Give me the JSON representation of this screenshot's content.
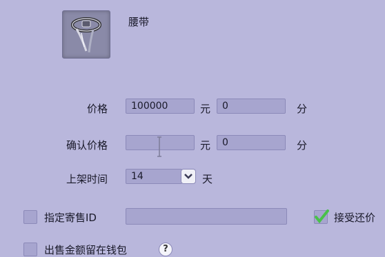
{
  "item": {
    "name": "腰带",
    "icon": "belt-icon"
  },
  "price": {
    "label": "价格",
    "yuan_value": "100000",
    "yuan_unit": "元",
    "fen_value": "0",
    "fen_unit": "分"
  },
  "confirm_price": {
    "label": "确认价格",
    "yuan_value": "",
    "yuan_unit": "元",
    "fen_value": "0",
    "fen_unit": "分"
  },
  "listing_time": {
    "label": "上架时间",
    "value": "14",
    "unit": "天"
  },
  "designated_buyer": {
    "label": "指定寄售ID",
    "checked": false,
    "value": ""
  },
  "accept_counteroffer": {
    "label": "接受还价",
    "checked": true
  },
  "proceeds_to_wallet": {
    "label": "出售金额留在钱包",
    "checked": false,
    "help_glyph": "?"
  },
  "colors": {
    "background": "#b9b7dc",
    "field": "#a7a5cf",
    "check": "#49c14a"
  }
}
